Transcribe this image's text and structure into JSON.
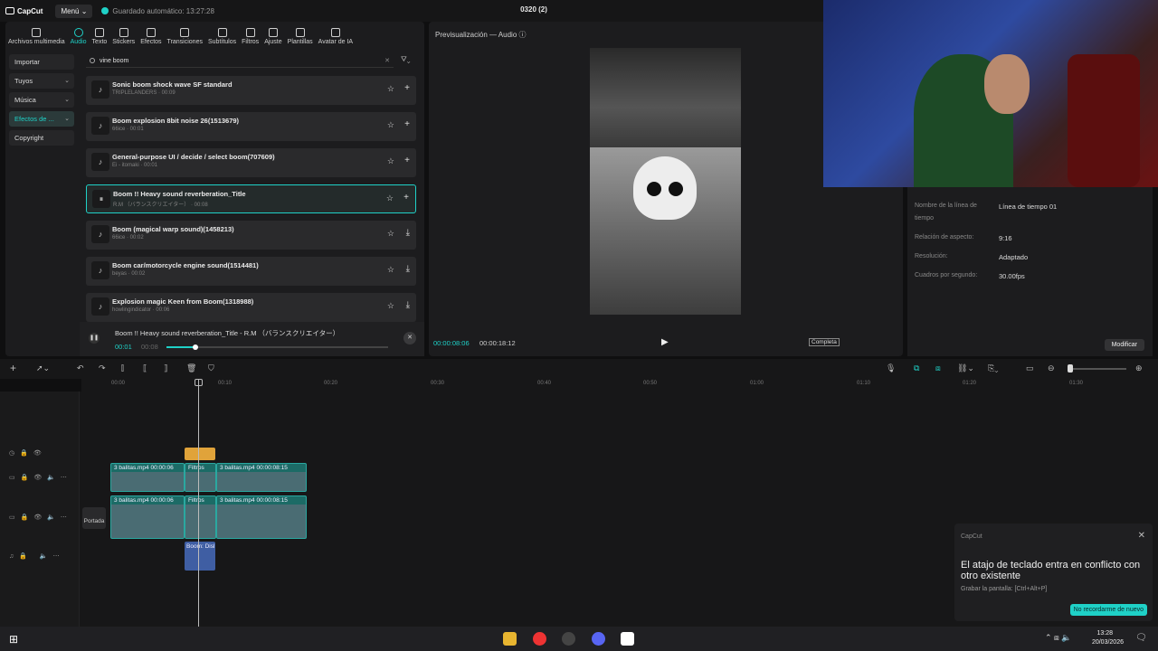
{
  "app": {
    "brand": "CapCut",
    "menu_label": "Menú",
    "autosave": "Guardado automático: 13:27:28",
    "project_title": "0320 (2)"
  },
  "tabs": [
    {
      "label": "Archivos multimedia",
      "icon": "media-icon"
    },
    {
      "label": "Audio",
      "icon": "audio-icon",
      "active": true
    },
    {
      "label": "Texto",
      "icon": "text-icon"
    },
    {
      "label": "Stickers",
      "icon": "sticker-icon"
    },
    {
      "label": "Efectos",
      "icon": "effects-icon"
    },
    {
      "label": "Transiciones",
      "icon": "transition-icon"
    },
    {
      "label": "Subtítulos",
      "icon": "subtitle-icon"
    },
    {
      "label": "Filtros",
      "icon": "filter-icon"
    },
    {
      "label": "Ajuste",
      "icon": "adjust-icon"
    },
    {
      "label": "Plantillas",
      "icon": "template-icon"
    },
    {
      "label": "Avatar de IA",
      "icon": "avatar-icon"
    }
  ],
  "sidebar": {
    "items": [
      {
        "label": "Importar",
        "chevron": ""
      },
      {
        "label": "Tuyos",
        "chevron": "⌄"
      },
      {
        "label": "Música",
        "chevron": "⌄"
      },
      {
        "label": "Efectos de ...",
        "chevron": "⌄",
        "active": true
      },
      {
        "label": "Copyright",
        "chevron": ""
      }
    ]
  },
  "search": {
    "value": "vine boom"
  },
  "results": [
    {
      "title": "Sonic boom shock wave SF standard",
      "sub": "TRIPLELANDERS · 00:09",
      "action": "+"
    },
    {
      "title": "Boom explosion 8bit noise 26(1513679)",
      "sub": "66ice · 00:01",
      "action": "+"
    },
    {
      "title": "General-purpose UI / decide / select boom(707609)",
      "sub": "Ei - itomaki · 00:01",
      "action": "+"
    },
    {
      "title": "Boom !! Heavy sound reverberation_Title",
      "sub": "R.M （バランスクリエイター） · 00:08",
      "action": "+",
      "selected": true
    },
    {
      "title": "Boom (magical warp sound)(1458213)",
      "sub": "66ice · 00:02",
      "action": "⤓"
    },
    {
      "title": "Boom car/motorcycle engine sound(1514481)",
      "sub": "beyas · 00:02",
      "action": "⤓"
    },
    {
      "title": "Explosion magic Keen from Boom(1318988)",
      "sub": "howlingindicator · 00:06",
      "action": "⤓"
    }
  ],
  "player": {
    "title": "Boom !! Heavy sound reverberation_Title - R.M （バランスクリエイター）",
    "current": "00:01",
    "total": "00:08",
    "progress": 0.13
  },
  "preview": {
    "title": "Previsualización — Audio",
    "time_current": "00:00:08:06",
    "time_total": "00:00:18:12",
    "ratio_label": "Completa"
  },
  "properties": [
    {
      "label": "Nombre de la línea de tiempo",
      "value": "Línea de tiempo 01"
    },
    {
      "label": "Relación de aspecto:",
      "value": "9:16"
    },
    {
      "label": "Resolución:",
      "value": "Adaptado"
    },
    {
      "label": "Cuadros por segundo:",
      "value": "30.00fps"
    }
  ],
  "modify_label": "Modificar",
  "ruler": [
    "00:00",
    "00:10",
    "00:20",
    "00:30",
    "00:40",
    "00:50",
    "01:00",
    "01:10",
    "01:20",
    "01:30"
  ],
  "timeline": {
    "clips": [
      {
        "name": "3 balitas.mp4",
        "dur": "00:00:06"
      },
      {
        "name": "Filtros",
        "dur": ""
      },
      {
        "name": "3 balitas.mp4",
        "dur": "00:00:08:15"
      }
    ],
    "cover_label": "Portada",
    "audio_clip": "Boom: Disl"
  },
  "notification": {
    "brand": "CapCut",
    "message": "El atajo de teclado entra en conflicto con otro existente",
    "hint": "Grabar la pantalla: [Ctrl+Alt+P]",
    "button": "No recordarme de nuevo"
  },
  "taskbar": {
    "time": "13:28",
    "date": "20/03/2026"
  },
  "colors": {
    "accent": "#1fd1c7",
    "clip": "#1c6b66",
    "fx_clip": "#e0a33a",
    "audio_clip": "#3f5ea3"
  }
}
